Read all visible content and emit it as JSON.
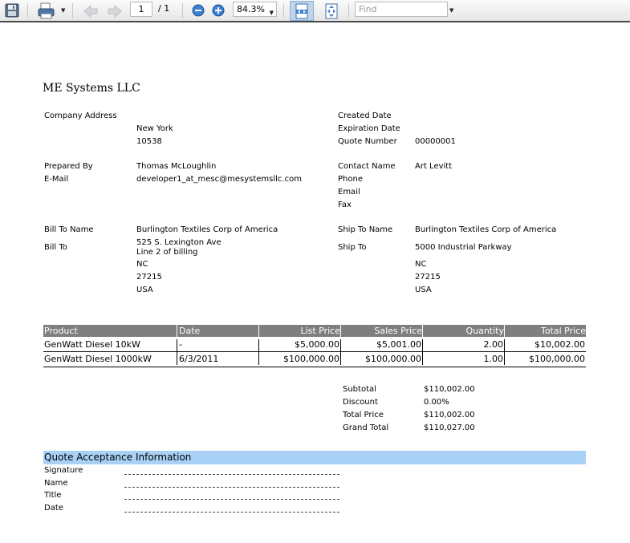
{
  "toolbar": {
    "save_icon": "save-icon",
    "print_icon": "print-icon",
    "page_current": "1",
    "page_total": "/ 1",
    "zoom_value": "84.3%",
    "find_placeholder": "Find"
  },
  "company": "ME Systems LLC",
  "info": {
    "company_address_label": "Company Address",
    "address_city": "New York",
    "address_zip": "10538",
    "created_date_label": "Created Date",
    "expiration_date_label": "Expiration Date",
    "quote_number_label": "Quote Number",
    "quote_number": "00000001",
    "prepared_by_label": "Prepared By",
    "prepared_by": "Thomas McLoughlin",
    "email_label": "E-Mail",
    "email": "developer1_at_mesc@mesystemsllc.com",
    "contact_name_label": "Contact Name",
    "contact_name": "Art Levitt",
    "phone_label": "Phone",
    "contact_email_label": "Email",
    "fax_label": "Fax",
    "bill_to_name_label": "Bill To Name",
    "bill_to_name": "Burlington Textiles Corp of America",
    "bill_to_label": "Bill To",
    "bill_street": "525 S. Lexington Ave",
    "bill_street2": "Line 2 of billing",
    "bill_state": "NC",
    "bill_zip": "27215",
    "bill_country": "USA",
    "ship_to_name_label": "Ship To Name",
    "ship_to_name": "Burlington Textiles Corp of America",
    "ship_to_label": "Ship To",
    "ship_street": "5000 Industrial Parkway",
    "ship_state": "NC",
    "ship_zip": "27215",
    "ship_country": "USA"
  },
  "products": {
    "headers": [
      "Product",
      "Date",
      "List Price",
      "Sales Price",
      "Quantity",
      "Total Price"
    ],
    "rows": [
      [
        "GenWatt Diesel 10kW",
        "-",
        "$5,000.00",
        "$5,001.00",
        "2.00",
        "$10,002.00"
      ],
      [
        "GenWatt Diesel 1000kW",
        "6/3/2011",
        "$100,000.00",
        "$100,000.00",
        "1.00",
        "$100,000.00"
      ]
    ]
  },
  "totals": {
    "subtotal_label": "Subtotal",
    "subtotal": "$110,002.00",
    "discount_label": "Discount",
    "discount": "0.00%",
    "total_price_label": "Total Price",
    "total_price": "$110,002.00",
    "grand_total_label": "Grand Total",
    "grand_total": "$110,027.00"
  },
  "acceptance": {
    "title": "Quote Acceptance Information",
    "signature_label": "Signature",
    "name_label": "Name",
    "title_label": "Title",
    "date_label": "Date"
  }
}
